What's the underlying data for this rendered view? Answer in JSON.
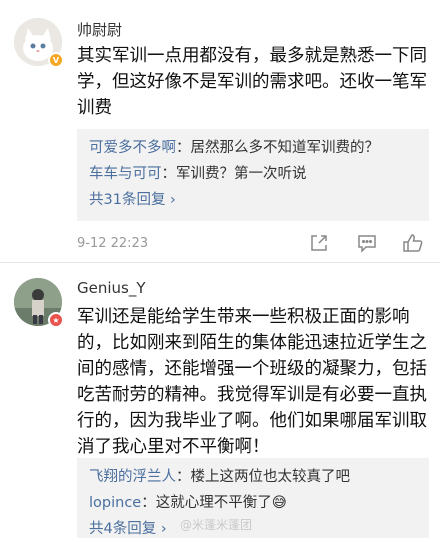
{
  "comments": [
    {
      "username": "帅尉尉",
      "content": "其实军训一点用都没有，最多就是熟悉一下同学，但这好像不是军训的需求吧。还收一笔军训费",
      "replies": [
        {
          "user": "可爱多不多啊",
          "text": "：居然那么多不知道军训费的？"
        },
        {
          "user": "车车与可可",
          "text": "：军训费？第一次听说"
        }
      ],
      "more_replies": "共31条回复 ›",
      "time": "9-12 22:23"
    },
    {
      "username": "Genius_Y",
      "content": "军训还是能给学生带来一些积极正面的影响的，比如刚来到陌生的集体能迅速拉近学生之间的感情，还能增强一个班级的凝聚力，包括吃苦耐劳的精神。我觉得军训是有必要一直执行的，因为我毕业了啊。他们如果哪届军训取消了我心里对不平衡啊！",
      "replies": [
        {
          "user": "飞翔的浮兰人",
          "text": "：楼上这两位也太较真了吧"
        },
        {
          "user": "lopince",
          "text": "：这就心理不平衡了😅"
        }
      ],
      "more_replies": "共4条回复 ›"
    }
  ],
  "watermark": "@米蓬米蓬团",
  "colors": {
    "link_blue": "#4b6f9f",
    "reply_bg": "#f2f2f2",
    "verified_gold": "#f5a623",
    "verified_red": "#e8524a"
  },
  "icons": [
    "share-icon",
    "comment-icon",
    "like-icon"
  ]
}
